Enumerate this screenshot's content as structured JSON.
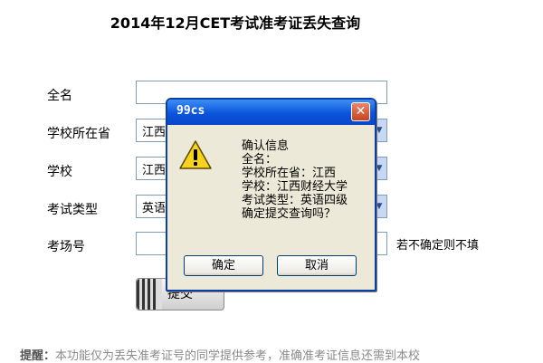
{
  "page": {
    "title": "2014年12月CET考试准考证丢失查询"
  },
  "form": {
    "name_label": "全名",
    "name_value": "",
    "province_label": "学校所在省",
    "province_value": "江西",
    "school_label": "学校",
    "school_value": "江西",
    "exam_type_label": "考试类型",
    "exam_type_value": "英语",
    "room_label": "考场号",
    "room_value": "",
    "room_hint": "若不确定则不填",
    "submit_label": "提交"
  },
  "dialog": {
    "title": "99cs",
    "close_glyph": "✕",
    "lines": [
      "确认信息",
      "全名：",
      "学校所在省：江西",
      "学校：江西财经大学",
      "考试类型：英语四级",
      "确定提交查询吗？"
    ],
    "ok_label": "确定",
    "cancel_label": "取消"
  },
  "notice": {
    "prefix": "提醒：",
    "text": "本功能仅为丢失准考证号的同学提供参考，准确准考证信息还需到本校"
  },
  "icons": {
    "warning": "warning-icon",
    "close": "close-icon",
    "dropdown": "chevron-down-icon"
  },
  "colors": {
    "titlebar": "#0a55dc",
    "dialog_bg": "#ece9d8",
    "input_border": "#7f9db9",
    "warning_yellow": "#f7d21e"
  }
}
